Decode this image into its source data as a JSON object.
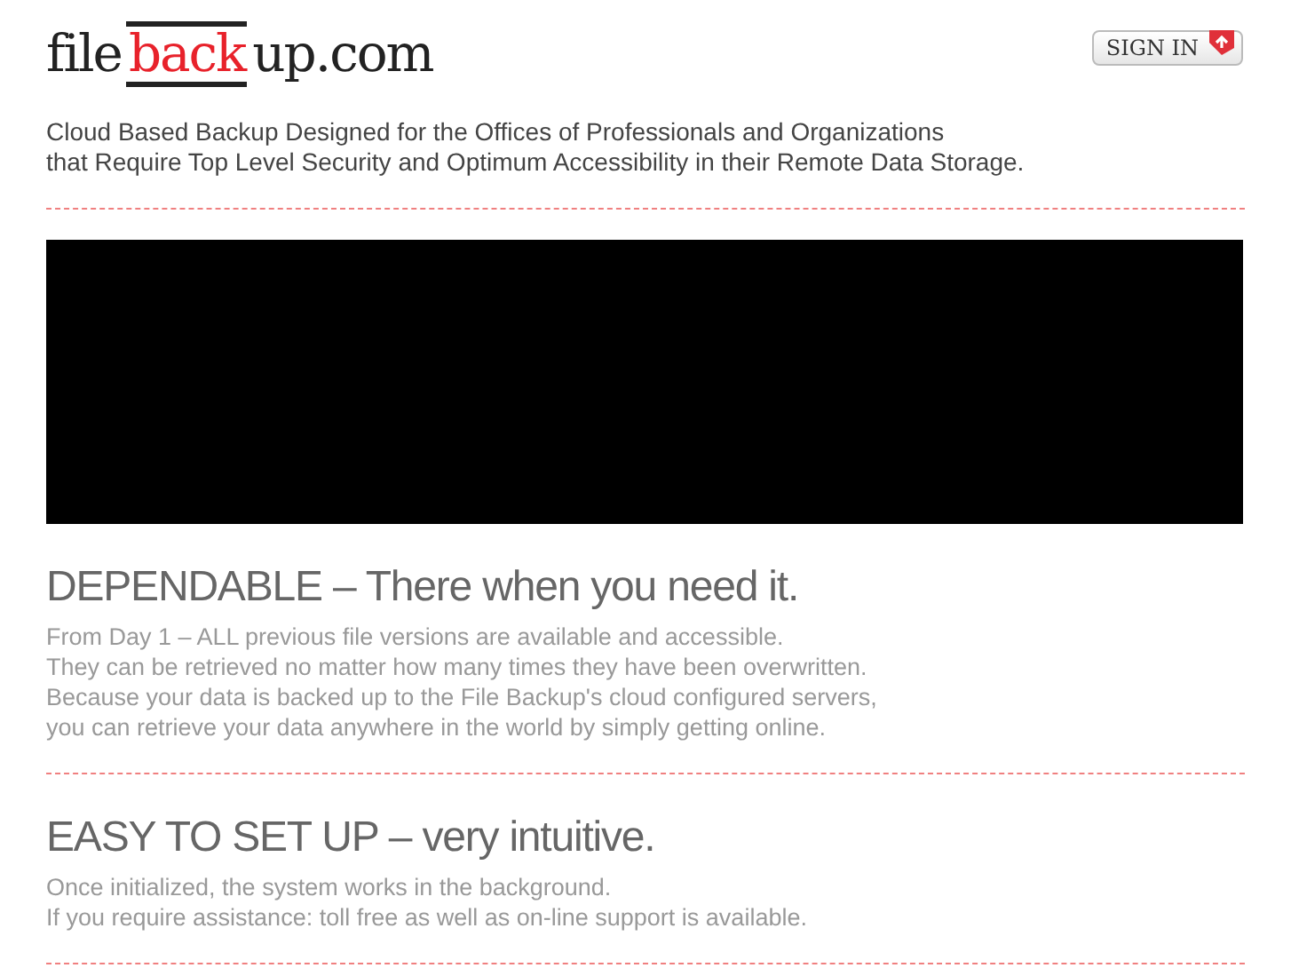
{
  "logo": {
    "parts": [
      {
        "text": "file",
        "kind": "plain"
      },
      {
        "text": "back",
        "kind": "highlight"
      },
      {
        "text": "up.com",
        "kind": "plain"
      }
    ]
  },
  "sign_in_button": {
    "label": "SIGN IN"
  },
  "tagline": [
    "Cloud Based Backup Designed for the Offices of Professionals and Organizations",
    "that Require Top Level Security and Optimum Accessibility in their Remote Data Storage."
  ],
  "video": {
    "kind": "video"
  },
  "sections": [
    {
      "heading": "DEPENDABLE – There when you need it.",
      "lines": [
        "From Day 1 – ALL previous file versions are available and accessible.",
        "They can be retrieved no matter how many times they have been overwritten.",
        "Because your data is backed up to the File Backup's cloud configured servers,",
        "you can retrieve your data anywhere in the world by simply getting online."
      ]
    },
    {
      "heading": "EASY TO SET UP – very intuitive.",
      "lines": [
        "Once initialized, the system works in the background.",
        "If you require assistance: toll free as well as on-line support is available."
      ]
    }
  ]
}
